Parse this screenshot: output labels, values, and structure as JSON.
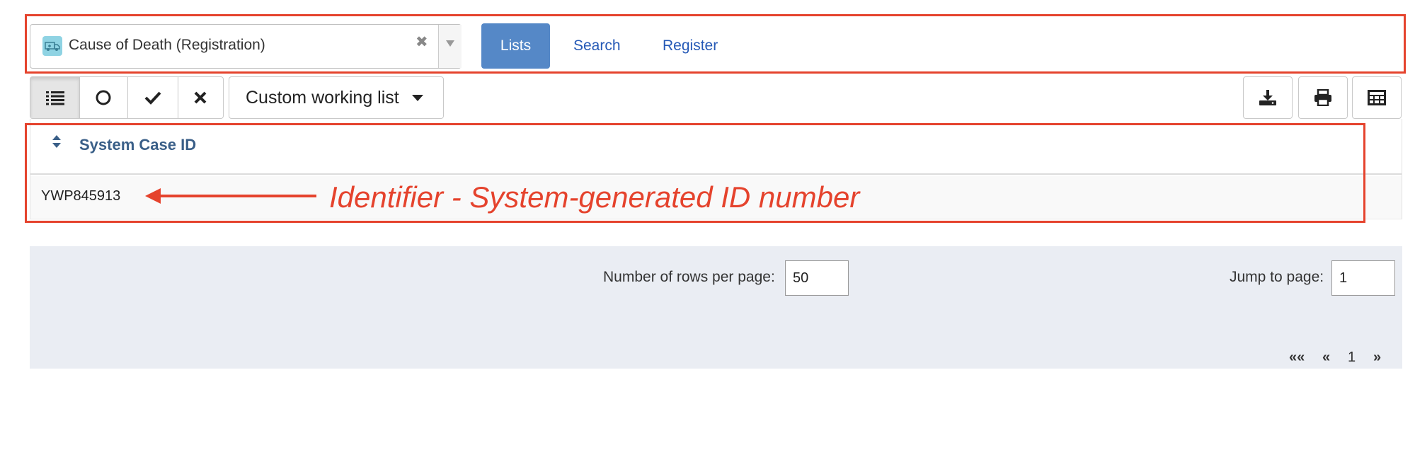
{
  "program": {
    "name": "Cause of Death (Registration)",
    "icon": "ambulance-icon",
    "clear_symbol": "✖"
  },
  "tabs": [
    {
      "label": "Lists",
      "active": true
    },
    {
      "label": "Search",
      "active": false
    },
    {
      "label": "Register",
      "active": false
    }
  ],
  "toolbar": {
    "filter_buttons": [
      {
        "icon": "list-icon",
        "active": true
      },
      {
        "icon": "circle-icon",
        "active": false
      },
      {
        "icon": "check-icon",
        "active": false
      },
      {
        "icon": "cross-icon",
        "active": false
      }
    ],
    "working_list_label": "Custom working list",
    "right_buttons": [
      "download-icon",
      "print-icon",
      "table-columns-icon"
    ]
  },
  "table": {
    "columns": [
      "System Case ID"
    ],
    "rows": [
      [
        "YWP845913"
      ]
    ]
  },
  "pager": {
    "rows_per_page_label": "Number of rows per page:",
    "rows_per_page_value": "50",
    "jump_label": "Jump to page:",
    "jump_value": "1",
    "first": "««",
    "prev": "«",
    "current": "1",
    "next": "»"
  },
  "annotation": {
    "text": "Identifier - System-generated ID number",
    "color": "#e5432d"
  },
  "colors": {
    "accent": "#5588c7",
    "link": "#2559b6",
    "header_text": "#3a5f88",
    "pager_bg": "#eaedf3"
  }
}
